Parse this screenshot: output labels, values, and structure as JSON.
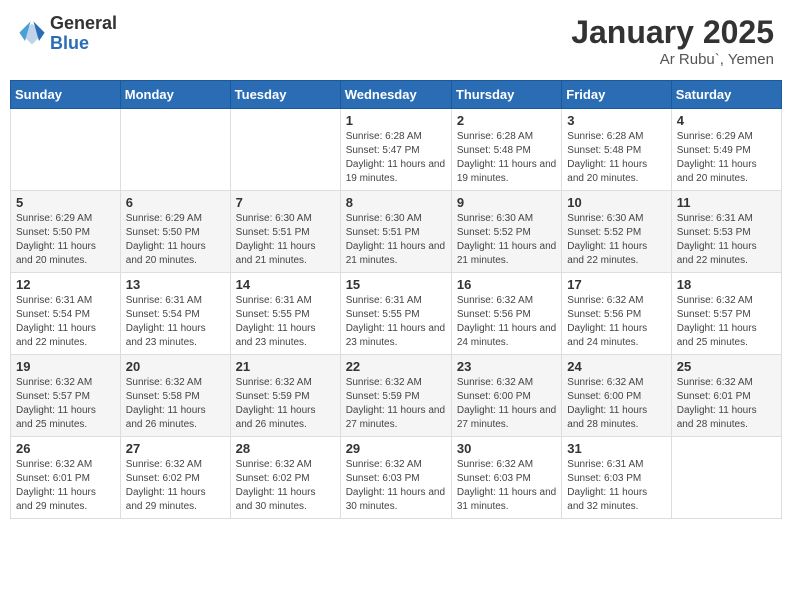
{
  "logo": {
    "general": "General",
    "blue": "Blue"
  },
  "header": {
    "title": "January 2025",
    "subtitle": "Ar Rubu`, Yemen"
  },
  "weekdays": [
    "Sunday",
    "Monday",
    "Tuesday",
    "Wednesday",
    "Thursday",
    "Friday",
    "Saturday"
  ],
  "weeks": [
    [
      {
        "day": "",
        "info": ""
      },
      {
        "day": "",
        "info": ""
      },
      {
        "day": "",
        "info": ""
      },
      {
        "day": "1",
        "info": "Sunrise: 6:28 AM\nSunset: 5:47 PM\nDaylight: 11 hours and 19 minutes."
      },
      {
        "day": "2",
        "info": "Sunrise: 6:28 AM\nSunset: 5:48 PM\nDaylight: 11 hours and 19 minutes."
      },
      {
        "day": "3",
        "info": "Sunrise: 6:28 AM\nSunset: 5:48 PM\nDaylight: 11 hours and 20 minutes."
      },
      {
        "day": "4",
        "info": "Sunrise: 6:29 AM\nSunset: 5:49 PM\nDaylight: 11 hours and 20 minutes."
      }
    ],
    [
      {
        "day": "5",
        "info": "Sunrise: 6:29 AM\nSunset: 5:50 PM\nDaylight: 11 hours and 20 minutes."
      },
      {
        "day": "6",
        "info": "Sunrise: 6:29 AM\nSunset: 5:50 PM\nDaylight: 11 hours and 20 minutes."
      },
      {
        "day": "7",
        "info": "Sunrise: 6:30 AM\nSunset: 5:51 PM\nDaylight: 11 hours and 21 minutes."
      },
      {
        "day": "8",
        "info": "Sunrise: 6:30 AM\nSunset: 5:51 PM\nDaylight: 11 hours and 21 minutes."
      },
      {
        "day": "9",
        "info": "Sunrise: 6:30 AM\nSunset: 5:52 PM\nDaylight: 11 hours and 21 minutes."
      },
      {
        "day": "10",
        "info": "Sunrise: 6:30 AM\nSunset: 5:52 PM\nDaylight: 11 hours and 22 minutes."
      },
      {
        "day": "11",
        "info": "Sunrise: 6:31 AM\nSunset: 5:53 PM\nDaylight: 11 hours and 22 minutes."
      }
    ],
    [
      {
        "day": "12",
        "info": "Sunrise: 6:31 AM\nSunset: 5:54 PM\nDaylight: 11 hours and 22 minutes."
      },
      {
        "day": "13",
        "info": "Sunrise: 6:31 AM\nSunset: 5:54 PM\nDaylight: 11 hours and 23 minutes."
      },
      {
        "day": "14",
        "info": "Sunrise: 6:31 AM\nSunset: 5:55 PM\nDaylight: 11 hours and 23 minutes."
      },
      {
        "day": "15",
        "info": "Sunrise: 6:31 AM\nSunset: 5:55 PM\nDaylight: 11 hours and 23 minutes."
      },
      {
        "day": "16",
        "info": "Sunrise: 6:32 AM\nSunset: 5:56 PM\nDaylight: 11 hours and 24 minutes."
      },
      {
        "day": "17",
        "info": "Sunrise: 6:32 AM\nSunset: 5:56 PM\nDaylight: 11 hours and 24 minutes."
      },
      {
        "day": "18",
        "info": "Sunrise: 6:32 AM\nSunset: 5:57 PM\nDaylight: 11 hours and 25 minutes."
      }
    ],
    [
      {
        "day": "19",
        "info": "Sunrise: 6:32 AM\nSunset: 5:57 PM\nDaylight: 11 hours and 25 minutes."
      },
      {
        "day": "20",
        "info": "Sunrise: 6:32 AM\nSunset: 5:58 PM\nDaylight: 11 hours and 26 minutes."
      },
      {
        "day": "21",
        "info": "Sunrise: 6:32 AM\nSunset: 5:59 PM\nDaylight: 11 hours and 26 minutes."
      },
      {
        "day": "22",
        "info": "Sunrise: 6:32 AM\nSunset: 5:59 PM\nDaylight: 11 hours and 27 minutes."
      },
      {
        "day": "23",
        "info": "Sunrise: 6:32 AM\nSunset: 6:00 PM\nDaylight: 11 hours and 27 minutes."
      },
      {
        "day": "24",
        "info": "Sunrise: 6:32 AM\nSunset: 6:00 PM\nDaylight: 11 hours and 28 minutes."
      },
      {
        "day": "25",
        "info": "Sunrise: 6:32 AM\nSunset: 6:01 PM\nDaylight: 11 hours and 28 minutes."
      }
    ],
    [
      {
        "day": "26",
        "info": "Sunrise: 6:32 AM\nSunset: 6:01 PM\nDaylight: 11 hours and 29 minutes."
      },
      {
        "day": "27",
        "info": "Sunrise: 6:32 AM\nSunset: 6:02 PM\nDaylight: 11 hours and 29 minutes."
      },
      {
        "day": "28",
        "info": "Sunrise: 6:32 AM\nSunset: 6:02 PM\nDaylight: 11 hours and 30 minutes."
      },
      {
        "day": "29",
        "info": "Sunrise: 6:32 AM\nSunset: 6:03 PM\nDaylight: 11 hours and 30 minutes."
      },
      {
        "day": "30",
        "info": "Sunrise: 6:32 AM\nSunset: 6:03 PM\nDaylight: 11 hours and 31 minutes."
      },
      {
        "day": "31",
        "info": "Sunrise: 6:31 AM\nSunset: 6:03 PM\nDaylight: 11 hours and 32 minutes."
      },
      {
        "day": "",
        "info": ""
      }
    ]
  ]
}
